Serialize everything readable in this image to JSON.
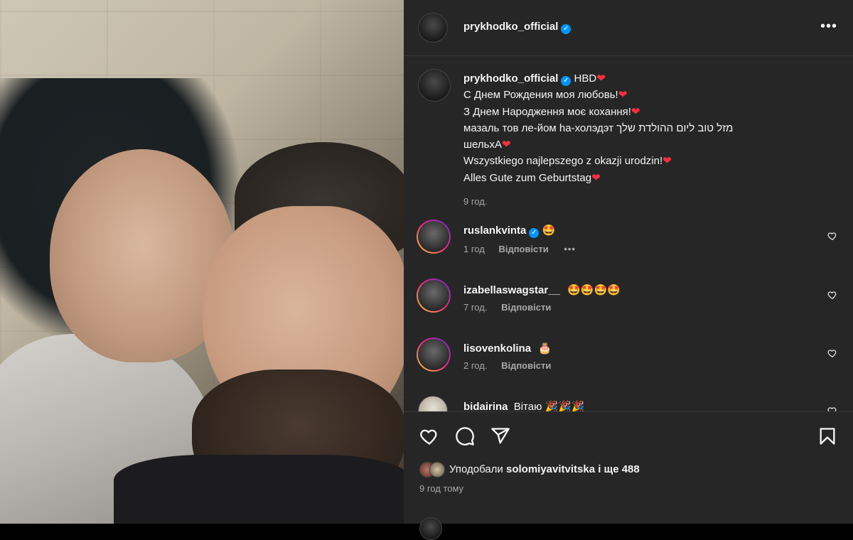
{
  "post": {
    "author": "prykhodko_official",
    "verified_mark": "✓",
    "more_icon": "more-horizontal-icon"
  },
  "caption": {
    "username": "prykhodko_official",
    "lines": [
      "HBD",
      "С Днем Рождения моя любовь!",
      "З Днем Народження моє кохання!",
      "מזל טוב ליום ההולדת שלך мазаль тов ле-йом hа-холэдэт",
      "шельхА",
      "Wszystkiego najlepszego z okazji urodzin!",
      "Alles Gute zum Geburtstag"
    ],
    "heart": "❤️",
    "time": "9 год."
  },
  "comments": [
    {
      "username": "ruslankvinta",
      "verified": true,
      "text": "🤩",
      "time": "1 год",
      "reply": "Відповісти",
      "more": "•••"
    },
    {
      "username": "izabellaswagstar__",
      "verified": false,
      "text": "🤩🤩🤩🤩",
      "time": "7 год.",
      "reply": "Відповісти"
    },
    {
      "username": "lisovenkolina",
      "verified": false,
      "text": "🎂",
      "time": "2 год.",
      "reply": "Відповісти"
    },
    {
      "username": "bidairina",
      "verified": false,
      "text": "Вітаю 🎉🎉🎉"
    }
  ],
  "likes": {
    "prefix": "Уподобали",
    "user": "solomiyavitvitska",
    "suffix": "і ще 488"
  },
  "posted": "9 год тому",
  "colors": {
    "panel_bg": "#262626",
    "heart_red": "#ff3040",
    "verified_blue": "#0095f6",
    "muted_text": "#a8a8a8"
  }
}
